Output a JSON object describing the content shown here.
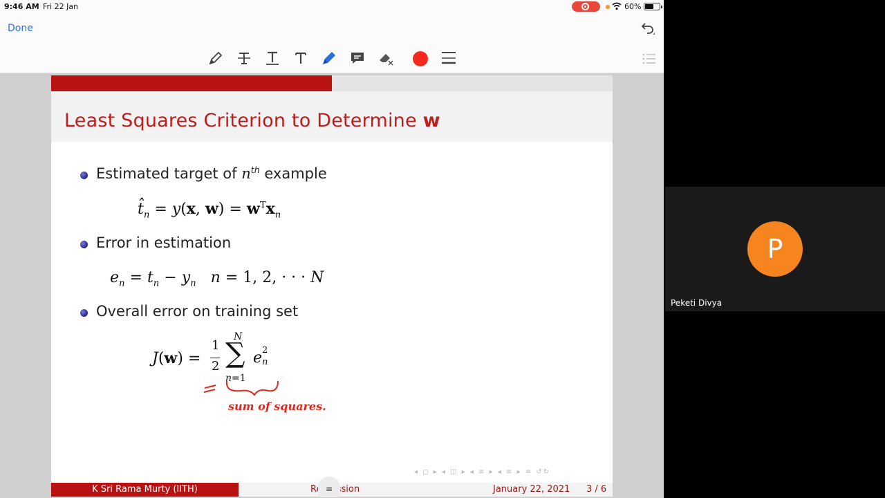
{
  "status": {
    "time": "9:46 AM",
    "date": "Fri 22 Jan",
    "battery_pct": "60%",
    "battery_level": 0.6
  },
  "nav": {
    "done_label": "Done"
  },
  "toolbar": {
    "tools": [
      "pen-icon",
      "strikethrough-icon",
      "underline-icon",
      "text-icon",
      "highlighter-icon",
      "comment-icon",
      "eraser-icon",
      "color-swatch",
      "line-width-icon"
    ],
    "active_color": "#f6291c"
  },
  "slide": {
    "progress": 0.5,
    "title": "Least Squares Criterion to Determine ",
    "title_bold": "w",
    "bullets": [
      "Estimated target of ",
      "Error in estimation",
      "Overall error on training set"
    ],
    "bullet1_var": "n",
    "bullet1_sup": "th",
    "bullet1_tail": " example",
    "handwriting": "sum of squares."
  },
  "footer": {
    "author": "K Sri Rama Murty  (IITH)",
    "topic": "Regression",
    "date": "January 22, 2021",
    "page": "3 / 6"
  },
  "participant": {
    "initial": "P",
    "name": "Peketi Divya",
    "avatar_color": "#f6851f"
  }
}
